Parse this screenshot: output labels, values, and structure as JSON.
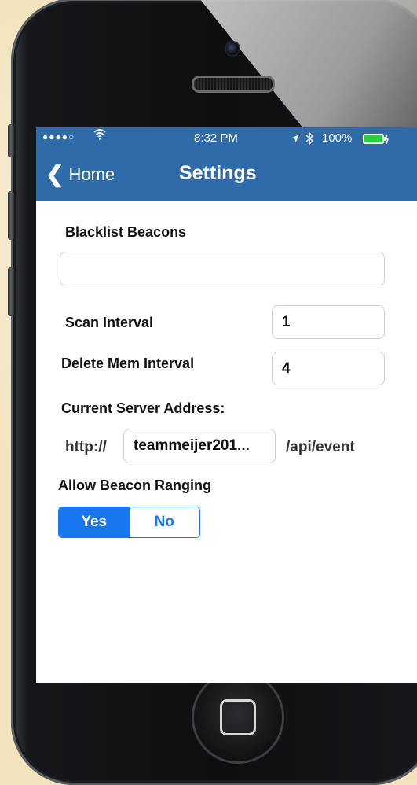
{
  "status_bar": {
    "signal": "●●●●○",
    "wifi_icon": "wifi-icon",
    "time": "8:32 PM",
    "location_icon": "location-arrow-icon",
    "bluetooth_icon": "bluetooth-icon",
    "battery_percent": "100%",
    "battery_icon": "battery-charging-icon"
  },
  "nav": {
    "back_label": "Home",
    "title": "Settings"
  },
  "form": {
    "blacklist_label": "Blacklist Beacons",
    "blacklist_value": "",
    "scan_interval_label": "Scan Interval",
    "scan_interval_value": "1",
    "delete_mem_label": "Delete Mem Interval",
    "delete_mem_value": "4",
    "server_label": "Current Server Address:",
    "server_prefix": "http://",
    "server_value": "teammeijer201...",
    "server_suffix": "/api/event",
    "ranging_label": "Allow Beacon Ranging",
    "ranging_options": [
      "Yes",
      "No"
    ],
    "ranging_selected": "Yes"
  },
  "colors": {
    "header": "#2f6aa9",
    "accent": "#1877ee",
    "background": "#f3e3bd"
  }
}
